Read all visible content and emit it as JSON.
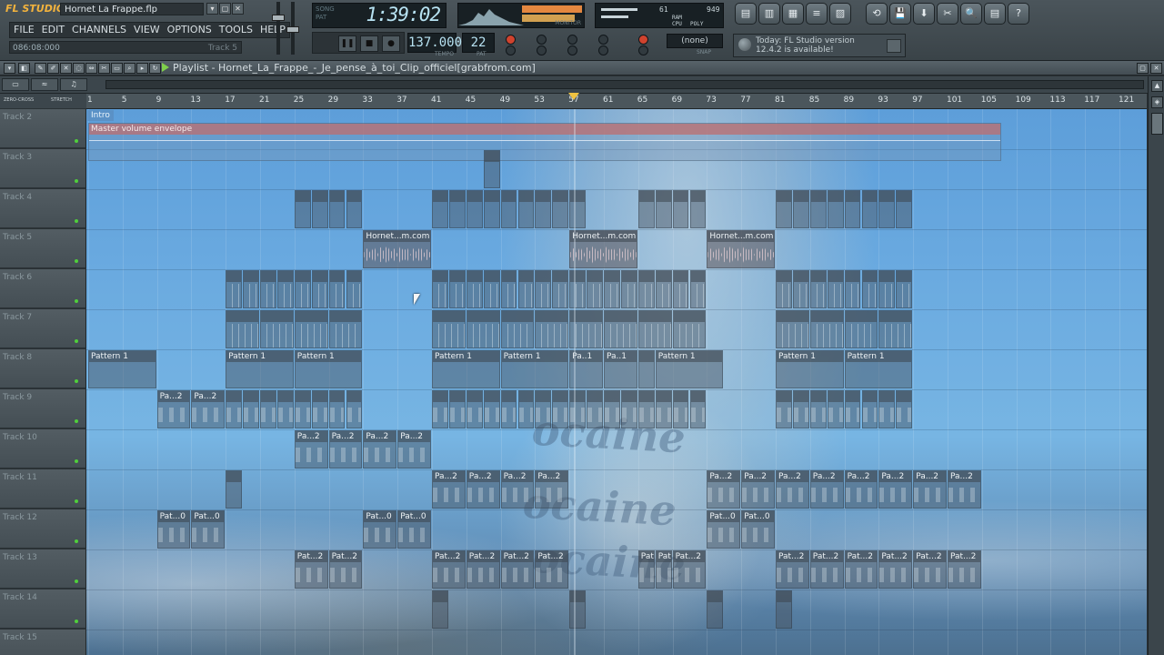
{
  "app": {
    "logo": "FL STUDIO",
    "file_title": "Hornet La Frappe.flp",
    "window_buttons": [
      "▾",
      "▢",
      "✕"
    ]
  },
  "menu": [
    "FILE",
    "EDIT",
    "CHANNELS",
    "VIEW",
    "OPTIONS",
    "TOOLS",
    "HELP"
  ],
  "hint_bar": {
    "position": "086:08:000",
    "track": "Track 5"
  },
  "transport": {
    "mode_labels": [
      "SONG",
      "PAT"
    ],
    "time": "1:39:02",
    "tempo": "137.000",
    "tempo_label": "TEMPO",
    "pattern": "22",
    "pattern_label": "PAT",
    "snap": "(none)",
    "snap_label": "SNAP",
    "monitor_label": "MONITOR",
    "buttons": [
      "❚❚",
      "■",
      "●"
    ]
  },
  "cpu": {
    "poly_count": "61",
    "ram_label": "RAM",
    "cpu_value": "949",
    "cpu_label": "CPU",
    "poly_label": "POLY"
  },
  "tool_icons": [
    "playlist-icon",
    "piano-roll-icon",
    "channel-rack-icon",
    "mixer-icon",
    "browser-icon",
    "undo-icon",
    "save-icon",
    "export-icon",
    "tools-icon",
    "search-icon",
    "notes-icon",
    "help-icon"
  ],
  "tool_glyphs": [
    "▤",
    "▥",
    "▦",
    "≡",
    "▨",
    "⟲",
    "💾",
    "⬇",
    "✂",
    "🔍",
    "▤",
    "?"
  ],
  "news": {
    "line1": "Today: FL Studio version",
    "line2": "12.4.2 is available!"
  },
  "playlist": {
    "title": "Playlist - Hornet_La_Frappe_-_Je_pense_à_toi_Clip_officiel[grabfrom.com]",
    "sub_buttons": [
      "▭",
      "≈",
      "♫"
    ],
    "ruler_left_labels": [
      "ZERO-CROSS",
      "STRETCH"
    ],
    "section_marker": "Intro",
    "bar_numbers": [
      "1",
      "5",
      "9",
      "13",
      "17",
      "21",
      "25",
      "29",
      "33",
      "37",
      "41",
      "45",
      "49",
      "53",
      "57",
      "61",
      "65",
      "69",
      "73",
      "77",
      "81",
      "85",
      "89",
      "93",
      "97",
      "101",
      "105",
      "109",
      "113",
      "117",
      "121"
    ],
    "tracks": [
      "Track 2",
      "Track 3",
      "Track 4",
      "Track 5",
      "Track 6",
      "Track 7",
      "Track 8",
      "Track 9",
      "Track 10",
      "Track 11",
      "Track 12",
      "Track 13",
      "Track 14",
      "Track 15"
    ],
    "envelope_label": "Master volume envelope",
    "audio_clip_label": "Hornet...m.com]",
    "pattern_1_label": "Pattern 1",
    "pattern_1_short": "Pa..1",
    "pa2_label": "Pa...2",
    "pat0_label": "Pat...0",
    "pat2_label": "Pat...2"
  }
}
